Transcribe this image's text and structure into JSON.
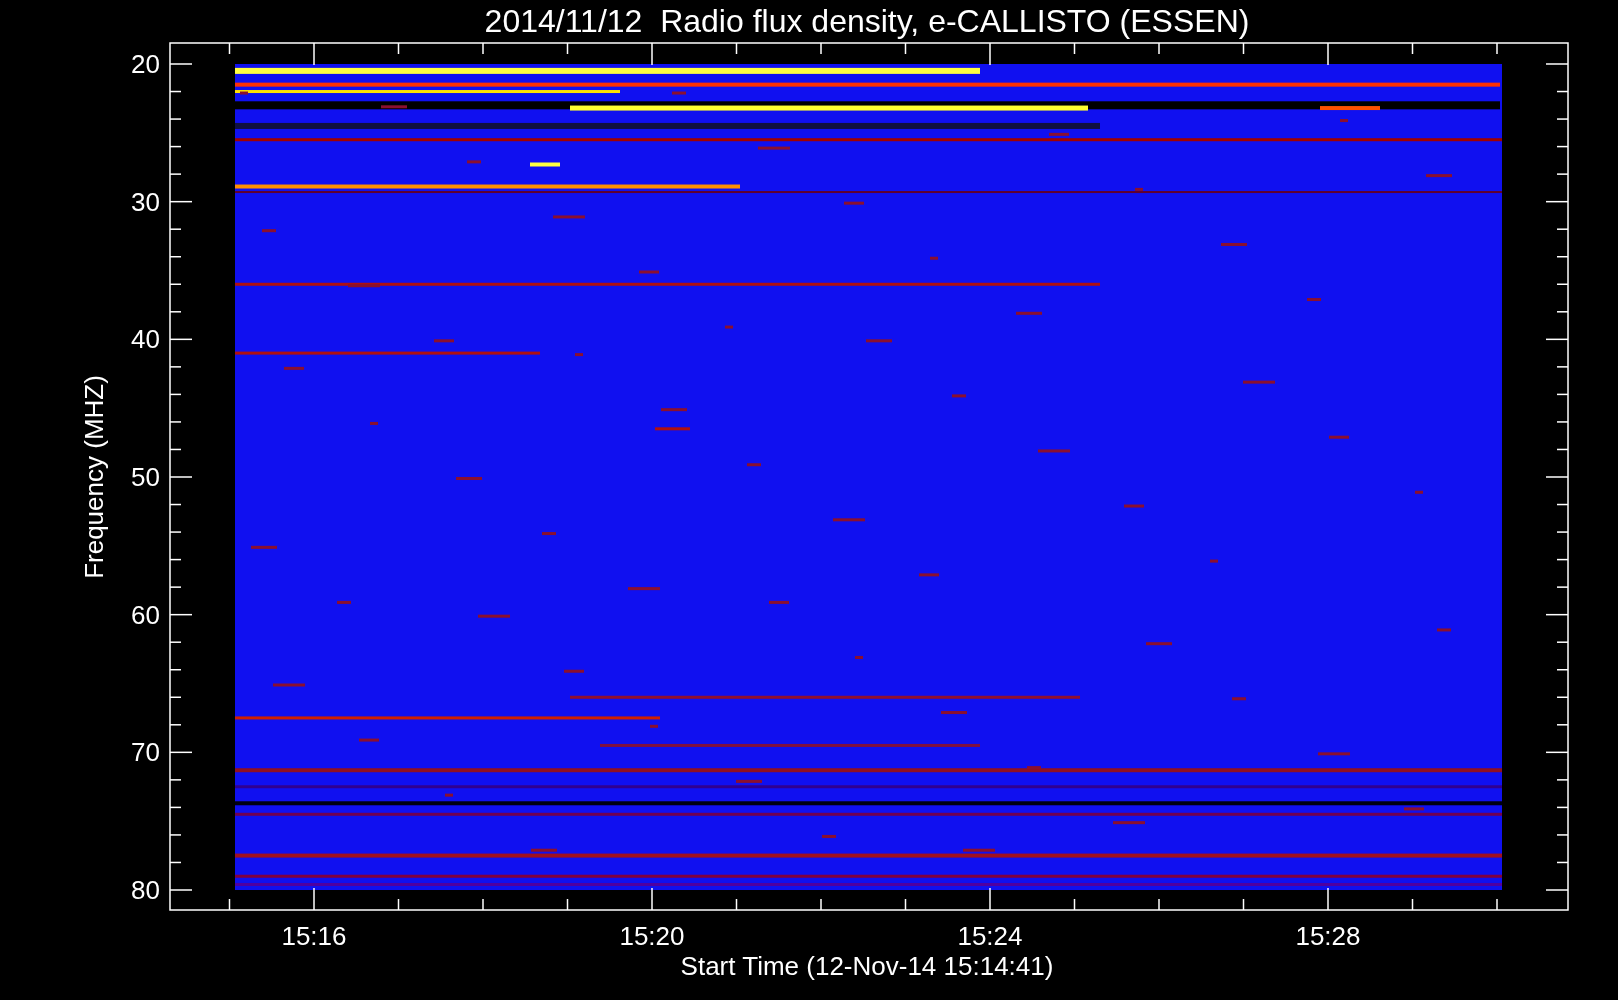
{
  "title": "2014/11/12  Radio flux density, e-CALLISTO (ESSEN)",
  "y_axis": {
    "label": "Frequency (MHZ)",
    "ticks": [
      "20",
      "30",
      "40",
      "50",
      "60",
      "70",
      "80"
    ]
  },
  "x_axis": {
    "label": "Start Time (12-Nov-14 15:14:41)",
    "ticks": [
      "15:16",
      "15:20",
      "15:24",
      "15:28"
    ]
  }
}
